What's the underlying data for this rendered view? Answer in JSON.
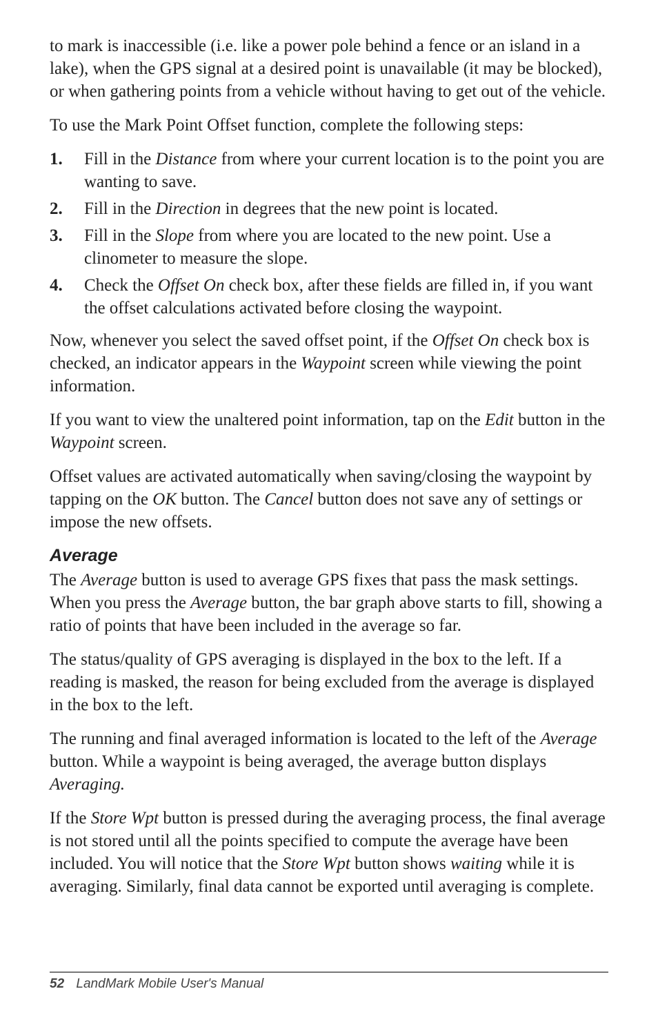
{
  "p1": "to mark is inaccessible (i.e. like a power pole behind a fence or an island in a lake), when the GPS signal at a desired point is unavailable (it may be blocked), or when gathering points from a vehicle without having to get out of the vehicle.",
  "p2": "To use the Mark Point Offset function, complete the following steps:",
  "steps": [
    {
      "num": "1.",
      "parts": [
        {
          "t": "Fill in the "
        },
        {
          "t": "Distance",
          "i": true
        },
        {
          "t": " from where your current location is to the point you are wanting to save."
        }
      ]
    },
    {
      "num": "2.",
      "parts": [
        {
          "t": "Fill in the "
        },
        {
          "t": "Direction",
          "i": true
        },
        {
          "t": " in degrees that the new point is located."
        }
      ]
    },
    {
      "num": "3.",
      "parts": [
        {
          "t": "Fill in the "
        },
        {
          "t": "Slope",
          "i": true
        },
        {
          "t": " from where you are located to the new point. Use a clinometer to measure the slope."
        }
      ]
    },
    {
      "num": "4.",
      "parts": [
        {
          "t": "Check the "
        },
        {
          "t": "Offset On",
          "i": true
        },
        {
          "t": " check box, after these fields are filled in, if you want the offset calculations activated before closing the waypoint."
        }
      ]
    }
  ],
  "p3": [
    {
      "t": "Now, whenever you select the saved offset point, if the "
    },
    {
      "t": "Offset On",
      "i": true
    },
    {
      "t": " check box is checked, an indicator appears in the "
    },
    {
      "t": "Waypoint",
      "i": true
    },
    {
      "t": " screen while viewing the point information."
    }
  ],
  "p4": [
    {
      "t": "If you want to view the unaltered point information, tap on the "
    },
    {
      "t": "Edit",
      "i": true
    },
    {
      "t": " button in the "
    },
    {
      "t": "Waypoint",
      "i": true
    },
    {
      "t": " screen."
    }
  ],
  "p5": [
    {
      "t": "Offset values are activated automatically when saving/closing the waypoint by tapping on the "
    },
    {
      "t": "OK",
      "i": true
    },
    {
      "t": " button. The "
    },
    {
      "t": "Cancel",
      "i": true
    },
    {
      "t": " button does not save any of settings or impose the new offsets."
    }
  ],
  "subhead": "Average",
  "p6": [
    {
      "t": "The "
    },
    {
      "t": "Average",
      "i": true
    },
    {
      "t": " button is used to average GPS fixes that pass the mask settings. When you press the "
    },
    {
      "t": "Average",
      "i": true
    },
    {
      "t": " button, the bar graph above starts to fill, showing a ratio of points that have been included in the average so far."
    }
  ],
  "p7": "The status/quality of GPS averaging is displayed in the box to the left. If a reading is masked, the reason for being excluded from the average is displayed in the box to the left.",
  "p8": [
    {
      "t": "The running and final averaged information is located to the left of the "
    },
    {
      "t": "Average",
      "i": true
    },
    {
      "t": " button. While a waypoint is being averaged, the average button displays "
    },
    {
      "t": "Averaging.",
      "i": true
    }
  ],
  "p9": [
    {
      "t": "If the "
    },
    {
      "t": "Store Wpt",
      "i": true
    },
    {
      "t": " button is pressed during the averaging process, the final average is not stored until all the points specified to compute the average have been included. You will notice that the "
    },
    {
      "t": "Store Wpt",
      "i": true
    },
    {
      "t": " button shows "
    },
    {
      "t": "waiting",
      "i": true
    },
    {
      "t": " while it is averaging. Similarly, final data cannot be exported until averaging is complete."
    }
  ],
  "footer": {
    "page": "52",
    "title": "LandMark Mobile User's Manual"
  }
}
